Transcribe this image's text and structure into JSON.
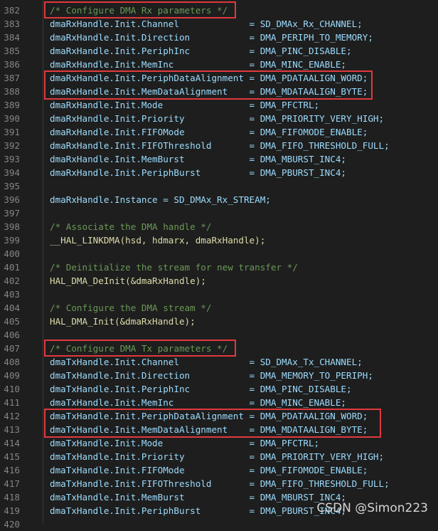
{
  "watermark": "CSDN @Simon223",
  "lines": [
    {
      "n": "382",
      "code": "/* Configure DMA Rx parameters */",
      "kind": "cmt"
    },
    {
      "n": "383",
      "code": "dmaRxHandle.Init.Channel             = SD_DMAx_Rx_CHANNEL;",
      "kind": "var"
    },
    {
      "n": "384",
      "code": "dmaRxHandle.Init.Direction           = DMA_PERIPH_TO_MEMORY;",
      "kind": "var"
    },
    {
      "n": "385",
      "code": "dmaRxHandle.Init.PeriphInc           = DMA_PINC_DISABLE;",
      "kind": "var"
    },
    {
      "n": "386",
      "code": "dmaRxHandle.Init.MemInc              = DMA_MINC_ENABLE;",
      "kind": "var"
    },
    {
      "n": "387",
      "code": "dmaRxHandle.Init.PeriphDataAlignment = DMA_PDATAALIGN_WORD;",
      "kind": "var"
    },
    {
      "n": "388",
      "code": "dmaRxHandle.Init.MemDataAlignment    = DMA_MDATAALIGN_BYTE;",
      "kind": "var"
    },
    {
      "n": "389",
      "code": "dmaRxHandle.Init.Mode                = DMA_PFCTRL;",
      "kind": "var"
    },
    {
      "n": "390",
      "code": "dmaRxHandle.Init.Priority            = DMA_PRIORITY_VERY_HIGH;",
      "kind": "var"
    },
    {
      "n": "391",
      "code": "dmaRxHandle.Init.FIFOMode            = DMA_FIFOMODE_ENABLE;",
      "kind": "var"
    },
    {
      "n": "392",
      "code": "dmaRxHandle.Init.FIFOThreshold       = DMA_FIFO_THRESHOLD_FULL;",
      "kind": "var"
    },
    {
      "n": "393",
      "code": "dmaRxHandle.Init.MemBurst            = DMA_MBURST_INC4;",
      "kind": "var"
    },
    {
      "n": "394",
      "code": "dmaRxHandle.Init.PeriphBurst         = DMA_PBURST_INC4;",
      "kind": "var"
    },
    {
      "n": "395",
      "code": "",
      "kind": "plain"
    },
    {
      "n": "396",
      "code": "dmaRxHandle.Instance = SD_DMAx_Rx_STREAM;",
      "kind": "var"
    },
    {
      "n": "397",
      "code": "",
      "kind": "plain"
    },
    {
      "n": "398",
      "code": "/* Associate the DMA handle */",
      "kind": "cmt"
    },
    {
      "n": "399",
      "code": "__HAL_LINKDMA(hsd, hdmarx, dmaRxHandle);",
      "kind": "fn"
    },
    {
      "n": "400",
      "code": "",
      "kind": "plain"
    },
    {
      "n": "401",
      "code": "/* Deinitialize the stream for new transfer */",
      "kind": "cmt"
    },
    {
      "n": "402",
      "code": "HAL_DMA_DeInit(&dmaRxHandle);",
      "kind": "fn"
    },
    {
      "n": "403",
      "code": "",
      "kind": "plain"
    },
    {
      "n": "404",
      "code": "/* Configure the DMA stream */",
      "kind": "cmt"
    },
    {
      "n": "405",
      "code": "HAL_DMA_Init(&dmaRxHandle);",
      "kind": "fn"
    },
    {
      "n": "406",
      "code": "",
      "kind": "plain"
    },
    {
      "n": "407",
      "code": "/* Configure DMA Tx parameters */",
      "kind": "cmt"
    },
    {
      "n": "408",
      "code": "dmaTxHandle.Init.Channel             = SD_DMAx_Tx_CHANNEL;",
      "kind": "var"
    },
    {
      "n": "409",
      "code": "dmaTxHandle.Init.Direction           = DMA_MEMORY_TO_PERIPH;",
      "kind": "var"
    },
    {
      "n": "410",
      "code": "dmaTxHandle.Init.PeriphInc           = DMA_PINC_DISABLE;",
      "kind": "var"
    },
    {
      "n": "411",
      "code": "dmaTxHandle.Init.MemInc              = DMA_MINC_ENABLE;",
      "kind": "var"
    },
    {
      "n": "412",
      "code": "dmaTxHandle.Init.PeriphDataAlignment = DMA_PDATAALIGN_WORD;",
      "kind": "var"
    },
    {
      "n": "413",
      "code": "dmaTxHandle.Init.MemDataAlignment    = DMA_MDATAALIGN_BYTE;",
      "kind": "var"
    },
    {
      "n": "414",
      "code": "dmaTxHandle.Init.Mode                = DMA_PFCTRL;",
      "kind": "var"
    },
    {
      "n": "415",
      "code": "dmaTxHandle.Init.Priority            = DMA_PRIORITY_VERY_HIGH;",
      "kind": "var"
    },
    {
      "n": "416",
      "code": "dmaTxHandle.Init.FIFOMode            = DMA_FIFOMODE_ENABLE;",
      "kind": "var"
    },
    {
      "n": "417",
      "code": "dmaTxHandle.Init.FIFOThreshold       = DMA_FIFO_THRESHOLD_FULL;",
      "kind": "var"
    },
    {
      "n": "418",
      "code": "dmaTxHandle.Init.MemBurst            = DMA_MBURST_INC4;",
      "kind": "var"
    },
    {
      "n": "419",
      "code": "dmaTxHandle.Init.PeriphBurst         = DMA_PBURST_INC4;",
      "kind": "var"
    },
    {
      "n": "420",
      "code": "",
      "kind": "plain"
    }
  ],
  "highlight_color": "#e0393e"
}
